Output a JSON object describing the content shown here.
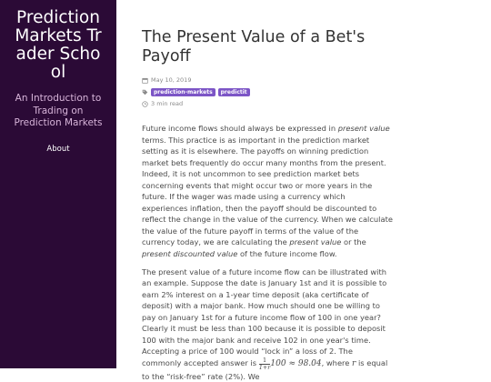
{
  "sidebar": {
    "title": "Prediction Markets Trader School",
    "description": "An Introduction to Trading on Prediction Markets",
    "nav": {
      "about": "About"
    }
  },
  "post": {
    "title": "The Present Value of a Bet's Payoff",
    "date": "May 10, 2019",
    "tags": [
      "prediction-markets",
      "predictit"
    ],
    "read_time": "3 min read",
    "p1": {
      "a": "Future income flows should always be expressed in ",
      "b": "present value",
      "c": " terms. This practice is as important in the prediction market setting as it is elsewhere. The payoffs on winning prediction market bets frequently do occur many months from the present. Indeed, it is not uncommon to see prediction market bets concerning events that might occur two or more years in the future. If the wager was made using a currency which experiences inflation, then the payoff should be discounted to reflect the change in the value of the currency. When we calculate the value of the future payoff in terms of the value of the currency today, we are calculating the ",
      "d": "present value",
      "e": " or the ",
      "f": "present discounted value",
      "g": " of the future income flow."
    },
    "p2": {
      "a": "The present value of a future income flow can be illustrated with an example. Suppose the date is January 1st and it is possible to earn 2% interest on a 1-year time deposit (aka certificate of deposit) with a major bank. How much should one be willing to pay on January 1st for a future income flow of 100 in one year? Clearly it must be less than 100 because it is possible to deposit 100 with the major bank and receive 102 in one year's time. Accepting a price of 100 would “lock in” a loss of 2. The commonly accepted answer is ",
      "frac_num": "1",
      "frac_den": "1+r",
      "math": "100 ≈ 98.04",
      "after_math": ", where ",
      "var_r": "r",
      "end": " is equal to the “risk-free” rate (2%). We"
    }
  }
}
